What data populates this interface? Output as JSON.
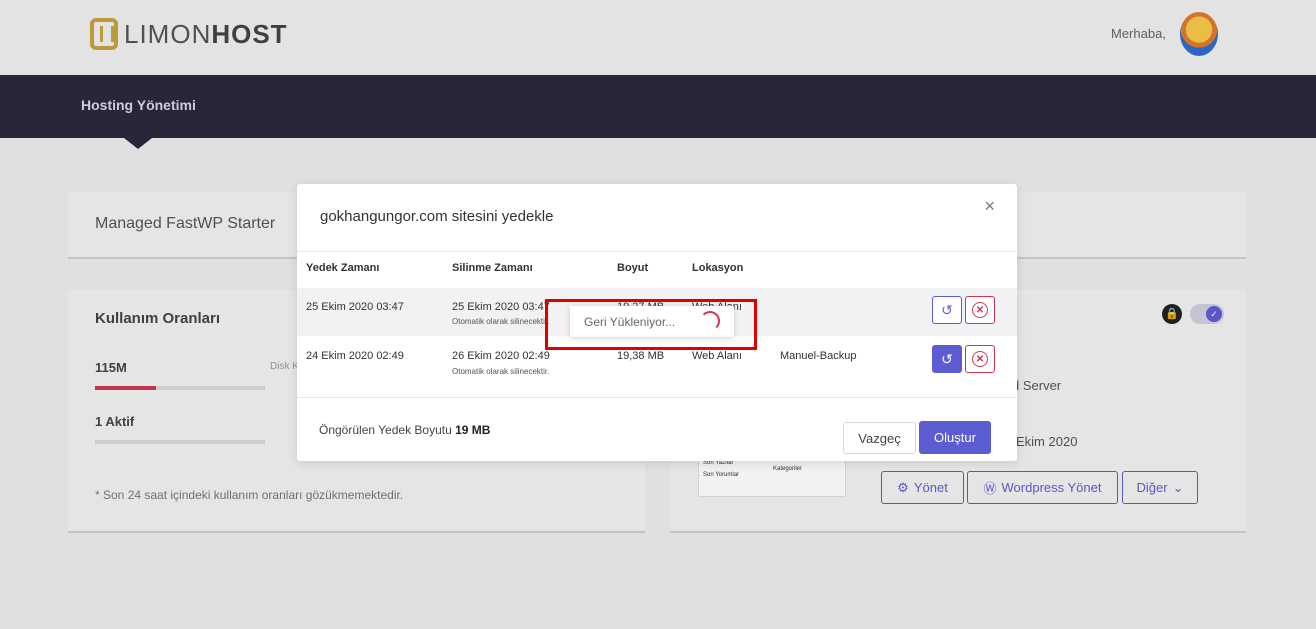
{
  "header": {
    "logo_text_light": "LIMON",
    "logo_text_bold": "HOST",
    "greeting": "Merhaba,",
    "nav_title": "Hosting Yönetimi"
  },
  "background": {
    "plan_title": "Managed FastWP Starter",
    "usage": {
      "title": "Kullanım Oranları",
      "disk_value": "115M",
      "disk_label": "Disk K",
      "disk_fraction": 0.36,
      "active_value": "1 Aktif",
      "footnote": "* Son 24 saat içindeki kullanım oranları gözükmemektedir."
    },
    "server_text": "d Server",
    "date_text": "Ekim 2020",
    "thumb_lines": [
      "Son Yazılar",
      "Kategoriler",
      "Son Yorumlar"
    ],
    "buttons": {
      "manage": "Yönet",
      "wordpress": "Wordpress Yönet",
      "other": "Diğer"
    }
  },
  "modal": {
    "title": "gokhangungor.com sitesini yedekle",
    "close": "×",
    "columns": [
      "Yedek Zamanı",
      "Silinme Zamanı",
      "Boyut",
      "Lokasyon"
    ],
    "rows": [
      {
        "backup_time": "25 Ekim 2020 03:47",
        "delete_time": "25 Ekim 2020 03:47",
        "delete_note": "Otomatik olarak silinecektir.",
        "size": "19,27 MB",
        "location": "Web Alanı",
        "type": ""
      },
      {
        "backup_time": "24 Ekim 2020 02:49",
        "delete_time": "26 Ekim 2020 02:49",
        "delete_note": "Otomatik olarak silinecektir.",
        "size": "19,38 MB",
        "location": "Web Alanı",
        "type": "Manuel-Backup"
      }
    ],
    "estimate_label": "Öngörülen Yedek Boyutu",
    "estimate_value": "19 MB",
    "cancel": "Vazgeç",
    "create": "Oluştur"
  },
  "loading": {
    "text": "Geri Yükleniyor..."
  },
  "colors": {
    "accent": "#5c5cd3",
    "danger": "#d0364f",
    "navbar": "#2a2a3d",
    "highlight": "#e00000"
  }
}
